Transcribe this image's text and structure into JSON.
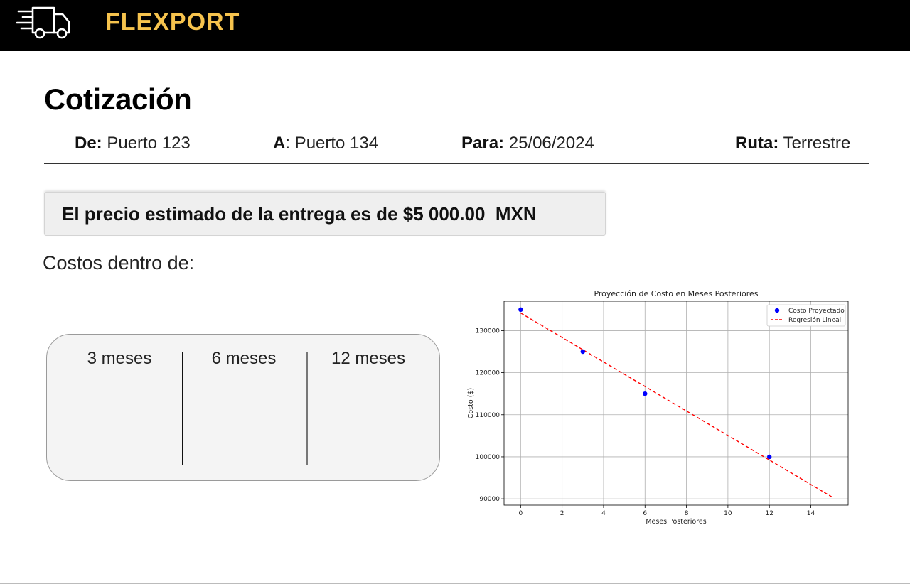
{
  "header": {
    "brand": "FLEXPORT",
    "logo_icon": "delivery-truck-icon",
    "background": "#000000",
    "brand_color": "#f6c34d"
  },
  "quote": {
    "title": "Cotización",
    "from_label": "De:",
    "from_value": "Puerto 123",
    "to_label": "A",
    "to_value": ": Puerto 134",
    "date_label": "Para:",
    "date_value": "25/06/2024",
    "route_label": "Ruta:",
    "route_value": "Terrestre",
    "price_text": "El precio estimado de la entrega es de $5 000.00  MXN",
    "costs_label": "Costos dentro de:",
    "periods": [
      "3 meses",
      "6 meses",
      "12 meses"
    ]
  },
  "chart_data": {
    "type": "scatter",
    "title": "Proyección de Costo en Meses Posteriores",
    "xlabel": "Meses Posteriores",
    "ylabel": "Costo ($)",
    "xlim": [
      -0.8,
      15.8
    ],
    "ylim": [
      88500,
      137000
    ],
    "xticks": [
      0,
      2,
      4,
      6,
      8,
      10,
      12,
      14
    ],
    "yticks": [
      90000,
      100000,
      110000,
      120000,
      130000
    ],
    "grid": true,
    "legend_position": "top-right",
    "series": [
      {
        "name": "Costo Proyectado",
        "kind": "scatter",
        "color": "#0000ff",
        "x": [
          0,
          3,
          6,
          12
        ],
        "y": [
          135000,
          125000,
          115000,
          100000
        ]
      },
      {
        "name": "Regresión Lineal",
        "kind": "line",
        "style": "dashed",
        "color": "#ff0000",
        "x": [
          0,
          15
        ],
        "y": [
          134200,
          90500
        ]
      }
    ]
  }
}
